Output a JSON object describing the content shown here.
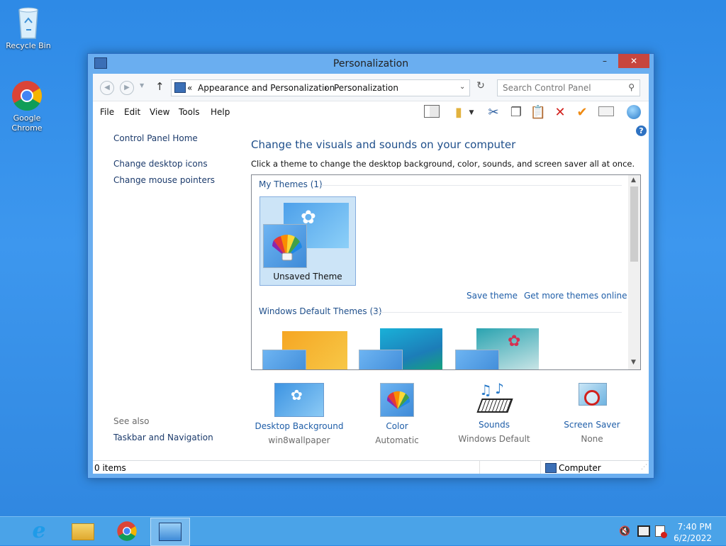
{
  "desktop": {
    "icons": [
      {
        "label": "Recycle Bin"
      },
      {
        "label": "Google Chrome"
      }
    ]
  },
  "window": {
    "title": "Personalization",
    "controls": {
      "minimize": "–",
      "maximize": "□",
      "close": "✕"
    },
    "address": {
      "overflow": "«",
      "crumb1": "Appearance and Personalization",
      "sep": "›",
      "crumb2": "Personalization"
    },
    "search_placeholder": "Search Control Panel",
    "menu": [
      "File",
      "Edit",
      "View",
      "Tools",
      "Help"
    ],
    "left_nav": {
      "home": "Control Panel Home",
      "links": [
        "Change desktop icons",
        "Change mouse pointers"
      ],
      "see_also_header": "See also",
      "see_also_link": "Taskbar and Navigation"
    },
    "main": {
      "title": "Change the visuals and sounds on your computer",
      "subtitle": "Click a theme to change the desktop background, color, sounds, and screen saver all at once.",
      "my_themes_header": "My Themes (1)",
      "unsaved_theme_label": "Unsaved Theme",
      "save_theme": "Save theme",
      "get_more": "Get more themes online",
      "default_themes_header": "Windows Default Themes (3)"
    },
    "bottom": [
      {
        "label": "Desktop Background",
        "value": "win8wallpaper"
      },
      {
        "label": "Color",
        "value": "Automatic"
      },
      {
        "label": "Sounds",
        "value": "Windows Default"
      },
      {
        "label": "Screen Saver",
        "value": "None"
      }
    ],
    "status": {
      "items": "0 items",
      "location": "Computer"
    }
  },
  "taskbar": {
    "time": "7:40 PM",
    "date": "6/2/2022"
  },
  "colors": {
    "link": "#1f5ea8",
    "accent": "#1f4f8b",
    "close": "#c7463e",
    "selected_tile": "#cce4f7"
  }
}
